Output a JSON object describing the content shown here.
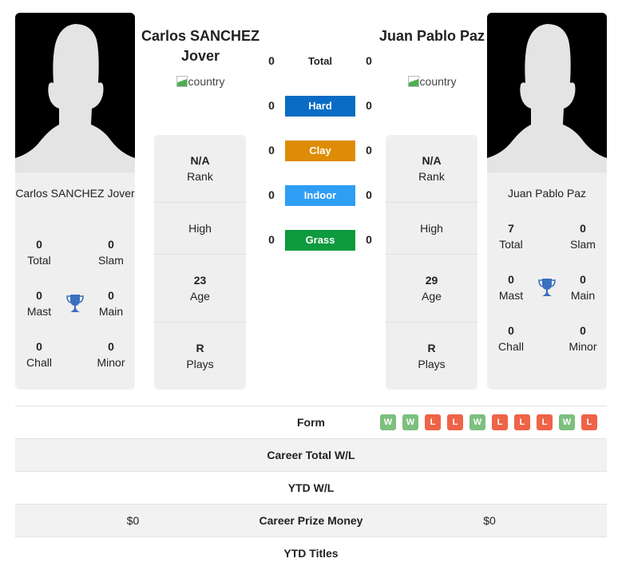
{
  "colors": {
    "hard": "#0a6cc4",
    "clay": "#de8c05",
    "indoor": "#2e9ef5",
    "grass": "#0e9a3e",
    "win": "#7dbf7d",
    "loss": "#ef6347",
    "trophy": "#3b6fc0"
  },
  "player1": {
    "name": "Carlos SANCHEZ Jover",
    "card_name": "Carlos SANCHEZ Jover",
    "flag_alt": "country",
    "titles": {
      "total": {
        "value": "0",
        "label": "Total"
      },
      "slam": {
        "value": "0",
        "label": "Slam"
      },
      "mast": {
        "value": "0",
        "label": "Mast"
      },
      "main": {
        "value": "0",
        "label": "Main"
      },
      "chall": {
        "value": "0",
        "label": "Chall"
      },
      "minor": {
        "value": "0",
        "label": "Minor"
      }
    },
    "info": {
      "rank": {
        "value": "N/A",
        "label": "Rank"
      },
      "high": {
        "value": "",
        "label": "High"
      },
      "age": {
        "value": "23",
        "label": "Age"
      },
      "plays": {
        "value": "R",
        "label": "Plays"
      }
    },
    "prize_money": "$0"
  },
  "player2": {
    "name": "Juan Pablo Paz",
    "card_name": "Juan Pablo Paz",
    "flag_alt": "country",
    "titles": {
      "total": {
        "value": "7",
        "label": "Total"
      },
      "slam": {
        "value": "0",
        "label": "Slam"
      },
      "mast": {
        "value": "0",
        "label": "Mast"
      },
      "main": {
        "value": "0",
        "label": "Main"
      },
      "chall": {
        "value": "0",
        "label": "Chall"
      },
      "minor": {
        "value": "0",
        "label": "Minor"
      }
    },
    "info": {
      "rank": {
        "value": "N/A",
        "label": "Rank"
      },
      "high": {
        "value": "",
        "label": "High"
      },
      "age": {
        "value": "29",
        "label": "Age"
      },
      "plays": {
        "value": "R",
        "label": "Plays"
      }
    },
    "prize_money": "$0"
  },
  "surfaces": [
    {
      "label": "Total",
      "p1": "0",
      "p2": "0"
    },
    {
      "label": "Hard",
      "p1": "0",
      "p2": "0"
    },
    {
      "label": "Clay",
      "p1": "0",
      "p2": "0"
    },
    {
      "label": "Indoor",
      "p1": "0",
      "p2": "0"
    },
    {
      "label": "Grass",
      "p1": "0",
      "p2": "0"
    }
  ],
  "table": {
    "form_label": "Form",
    "form": [
      "W",
      "W",
      "L",
      "L",
      "W",
      "L",
      "L",
      "L",
      "W",
      "L"
    ],
    "career_wl_label": "Career Total W/L",
    "ytd_wl_label": "YTD W/L",
    "prize_label": "Career Prize Money",
    "ytd_titles_label": "YTD Titles"
  }
}
